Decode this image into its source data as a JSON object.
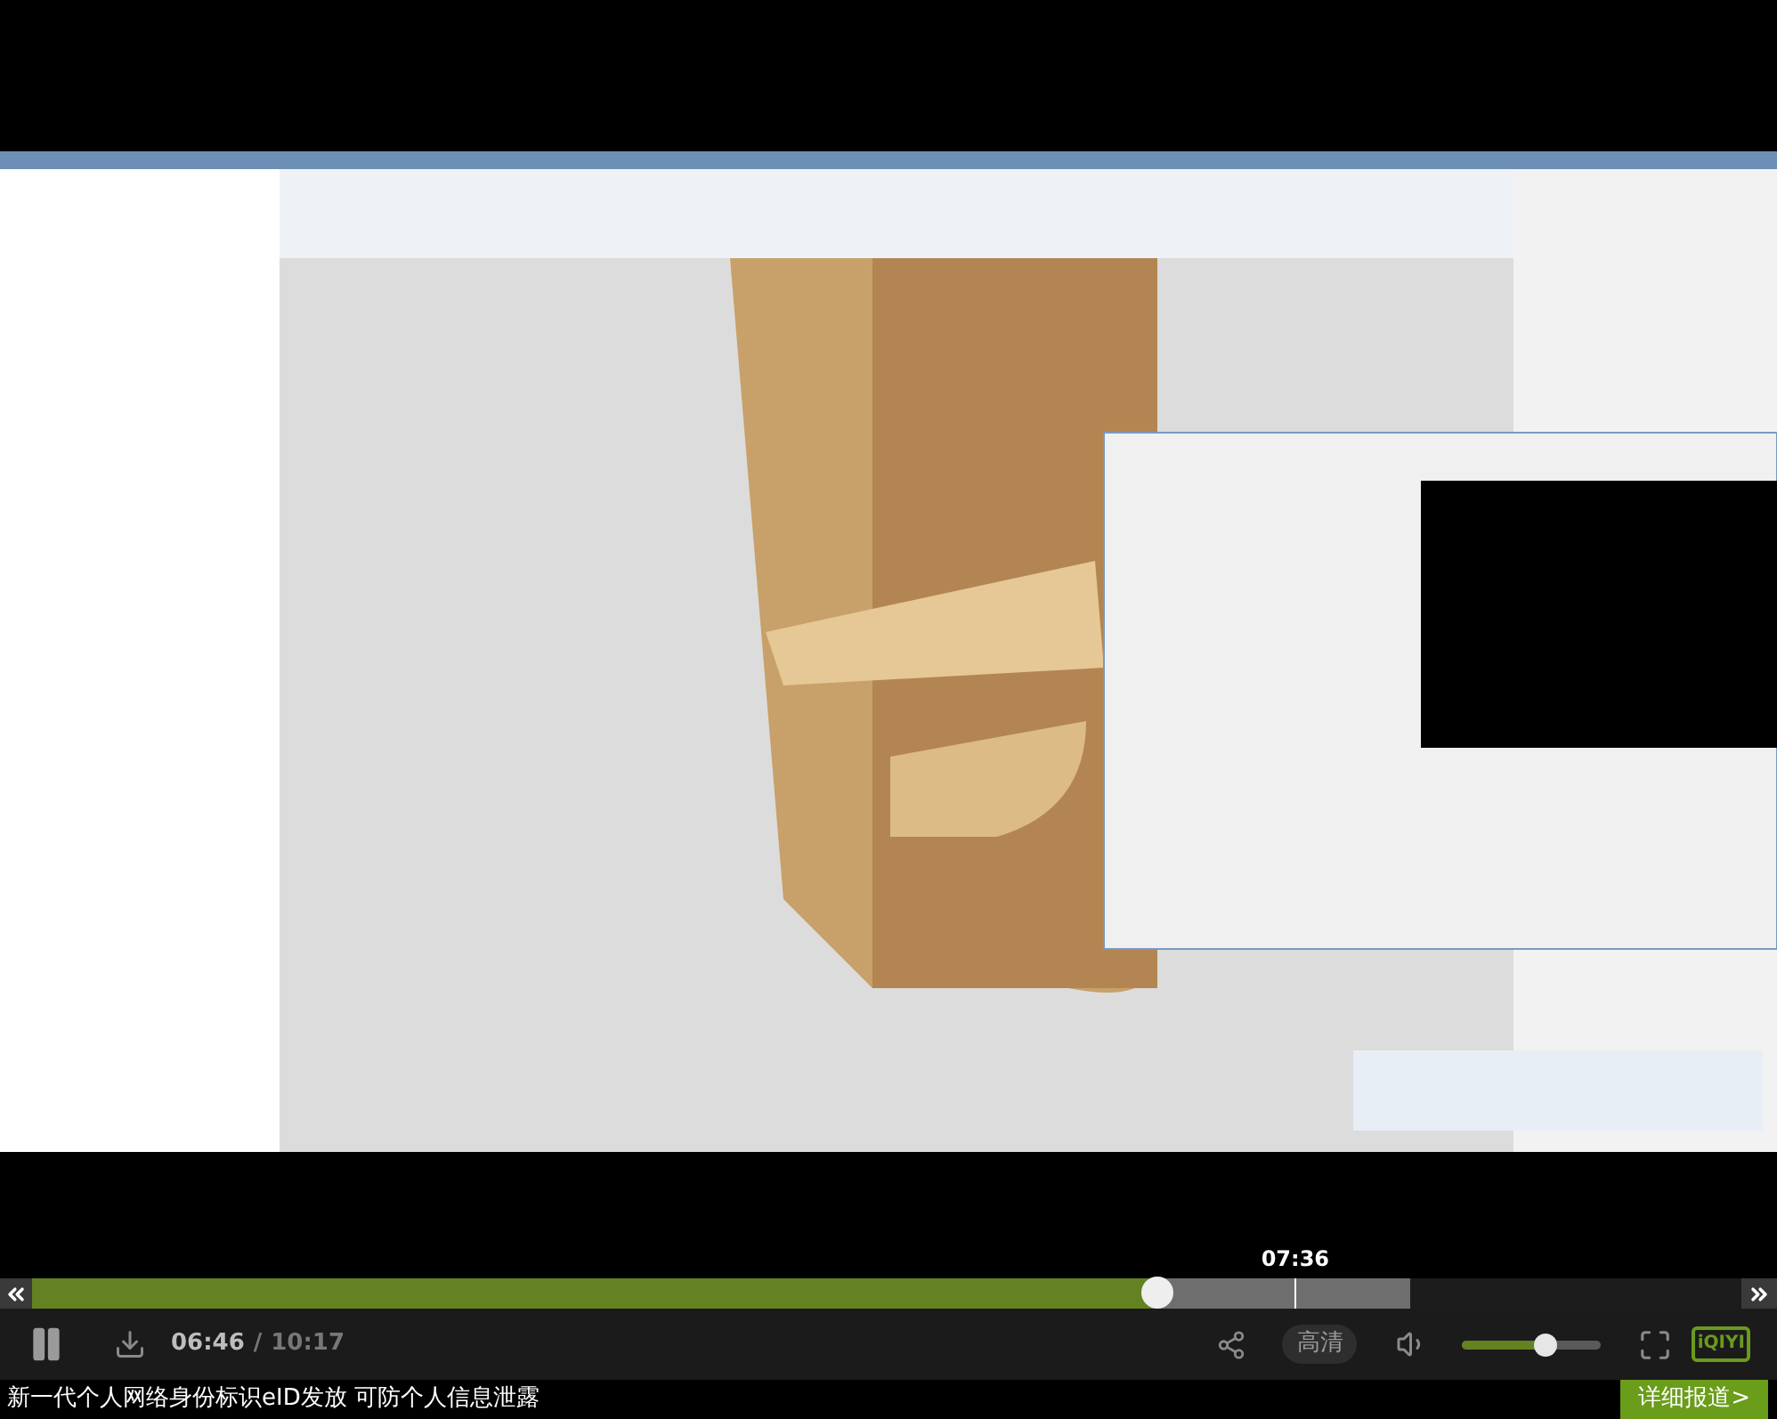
{
  "progress": {
    "level": 0.658,
    "buffer": {
      "level": 0.806
    },
    "hover": {
      "time": "07:36",
      "level": 0.739
    }
  },
  "controls": {
    "playing": true,
    "current_time": "06:46",
    "separator": "/",
    "duration": "10:17",
    "quality": "高清",
    "volume": {
      "level": 0.6
    },
    "logo": "iQIYI"
  },
  "ticker": {
    "headline": "新一代个人网络身份标识eID发放 可防个人信息泄露",
    "link": "详细报道>"
  }
}
